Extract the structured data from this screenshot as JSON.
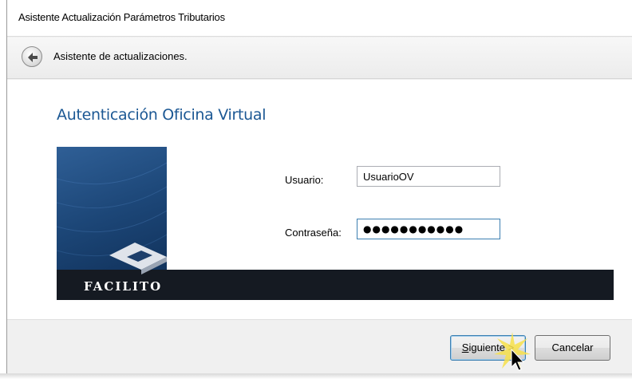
{
  "window": {
    "title": "Asistente Actualización Parámetros Tributarios"
  },
  "nav": {
    "label": "Asistente de actualizaciones."
  },
  "page": {
    "title": "Autenticación Oficina Virtual"
  },
  "banner": {
    "brand": "FACILITO"
  },
  "form": {
    "user_label": "Usuario:",
    "user_value": "UsuarioOV",
    "pass_label": "Contraseña:",
    "pass_value": "●●●●●●●●●●●"
  },
  "buttons": {
    "next_mnemonic": "S",
    "next_rest": "iguiente >",
    "cancel": "Cancelar"
  },
  "colors": {
    "title_blue": "#1c5894",
    "banner_dark": "#151a22",
    "banner_blue": "#1c4677"
  }
}
